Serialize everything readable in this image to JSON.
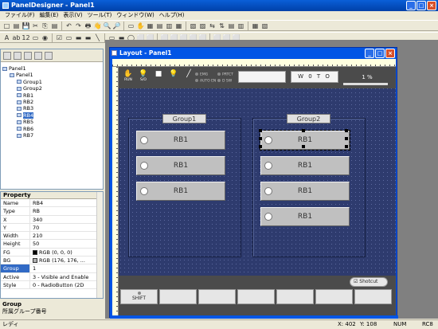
{
  "app": {
    "title": "PanelDesigner - Panel1"
  },
  "menu": [
    "ファイル(F)",
    "編集(E)",
    "表示(V)",
    "ツール(T)",
    "ウィンドウ(W)",
    "ヘルプ(H)"
  ],
  "toolbar1": [
    "□",
    "▤",
    "💾",
    "✂",
    "⎘",
    "▤",
    "↶",
    "↷",
    "🖶",
    "👋",
    "🔍",
    "🔎",
    "▭",
    "✋",
    "▦",
    "▤",
    "▥",
    "▦",
    "▧",
    "▨",
    "⇆",
    "⇅",
    "▤",
    "▥",
    "▦",
    "▧"
  ],
  "toolbar2": [
    "A",
    "ab",
    "12",
    "▭",
    "◉",
    "☑",
    "▭",
    "▬",
    "▬",
    "╲",
    "▭",
    "▬",
    "◯",
    "⬜",
    "⬜",
    "⬜",
    "⬜",
    "⬜",
    "⬜",
    "⬜",
    "⬜",
    "⬜",
    "⬜"
  ],
  "tree": {
    "items": [
      {
        "label": "Panel1",
        "indent": 0,
        "selected": false
      },
      {
        "label": "Panel1",
        "indent": 1,
        "selected": false
      },
      {
        "label": "Group1",
        "indent": 2,
        "selected": false
      },
      {
        "label": "Group2",
        "indent": 2,
        "selected": false
      },
      {
        "label": "RB1",
        "indent": 2,
        "selected": false
      },
      {
        "label": "RB2",
        "indent": 2,
        "selected": false
      },
      {
        "label": "RB3",
        "indent": 2,
        "selected": false
      },
      {
        "label": "RB4",
        "indent": 2,
        "selected": true
      },
      {
        "label": "RB5",
        "indent": 2,
        "selected": false
      },
      {
        "label": "RB6",
        "indent": 2,
        "selected": false
      },
      {
        "label": "RB7",
        "indent": 2,
        "selected": false
      }
    ]
  },
  "property": {
    "header": "Property",
    "rows": [
      {
        "k": "Name",
        "v": "RB4"
      },
      {
        "k": "Type",
        "v": "RB"
      },
      {
        "k": "X",
        "v": "340"
      },
      {
        "k": "Y",
        "v": "70"
      },
      {
        "k": "Width",
        "v": "210"
      },
      {
        "k": "Height",
        "v": "50"
      },
      {
        "k": "FG",
        "v": "RGB (0, 0, 0)",
        "swatch": "#000000"
      },
      {
        "k": "BG",
        "v": "RGB (176, 176, ...",
        "swatch": "#b0b0b0"
      },
      {
        "k": "Group",
        "v": "1",
        "selected": true
      },
      {
        "k": "Active",
        "v": "3 - Visible and Enable"
      },
      {
        "k": "Style",
        "v": "0 - RadioButton (2D"
      }
    ]
  },
  "desc": {
    "title": "Group",
    "text": "所属グループ番号"
  },
  "status": {
    "left": "レディ",
    "x": "X: 402",
    "y": "Y: 108",
    "num": "NUM",
    "rc": "RC8"
  },
  "layout": {
    "title": "Layout - Panel1",
    "header": {
      "icons": [
        {
          "sym": "✋",
          "label": "RUN"
        },
        {
          "sym": "💡",
          "label": "S/O"
        },
        {
          "sym": "■",
          "label": ""
        },
        {
          "sym": "💡",
          "label": ""
        },
        {
          "sym": "╱",
          "label": ""
        }
      ],
      "ind": [
        "EMG",
        "PRTCT",
        "AUTO EN",
        "D SW"
      ],
      "box2": "W 0 T O",
      "pct": "1 %"
    },
    "groups": [
      {
        "title": "Group1"
      },
      {
        "title": "Group2"
      }
    ],
    "rb_label": "RB1",
    "shotcut": "Shotcut",
    "fkey1": "SHIFT"
  }
}
